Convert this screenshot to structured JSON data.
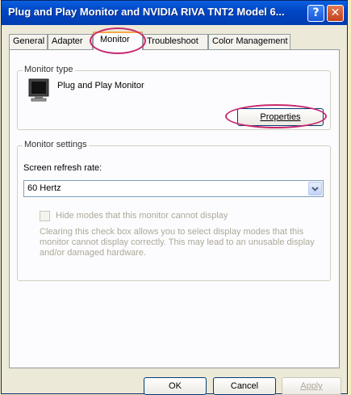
{
  "window": {
    "title": "Plug and Play Monitor and NVIDIA RIVA TNT2 Model 6...",
    "help_label": "?",
    "close_label": "✕"
  },
  "tabs": [
    {
      "label": "General"
    },
    {
      "label": "Adapter"
    },
    {
      "label": "Monitor",
      "active": true
    },
    {
      "label": "Troubleshoot"
    },
    {
      "label": "Color Management"
    }
  ],
  "monitor_type": {
    "legend": "Monitor type",
    "name": "Plug and Play Monitor",
    "icon": "monitor-icon",
    "properties_button": "Properties"
  },
  "monitor_settings": {
    "legend": "Monitor settings",
    "refresh_label": "Screen refresh rate:",
    "refresh_value": "60 Hertz",
    "hide_modes_label": "Hide modes that this monitor cannot display",
    "hide_modes_checked": false,
    "description": "Clearing this check box allows you to select display modes that this monitor cannot display correctly. This may lead to an unusable display and/or damaged hardware."
  },
  "footer": {
    "ok": "OK",
    "cancel": "Cancel",
    "apply": "Apply"
  },
  "colors": {
    "title_bar": "#0047c5",
    "highlight_ellipse": "#c8286e",
    "background": "#f3ecc2"
  }
}
